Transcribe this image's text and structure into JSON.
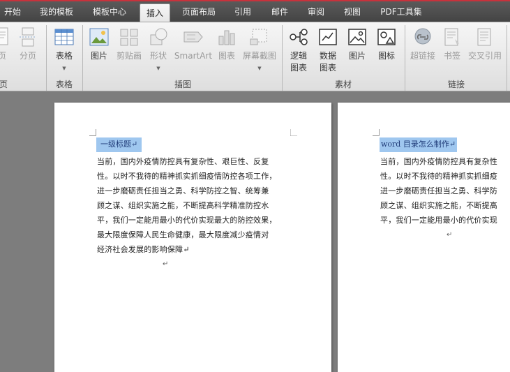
{
  "tabs": [
    {
      "label": "开始",
      "active": false
    },
    {
      "label": "我的模板",
      "active": false
    },
    {
      "label": "模板中心",
      "active": false
    },
    {
      "label": "插入",
      "active": true
    },
    {
      "label": "页面布局",
      "active": false
    },
    {
      "label": "引用",
      "active": false
    },
    {
      "label": "邮件",
      "active": false
    },
    {
      "label": "审阅",
      "active": false
    },
    {
      "label": "视图",
      "active": false
    },
    {
      "label": "PDF工具集",
      "active": false
    }
  ],
  "ribbon": {
    "buttons": {
      "page": "页",
      "page_break": "分页",
      "table": "表格",
      "picture": "图片",
      "clipart": "剪贴画",
      "shapes": "形状",
      "smartart": "SmartArt",
      "chart": "图表",
      "screenshot": "屏幕截图",
      "logic_chart_line1": "逻辑",
      "logic_chart_line2": "图表",
      "data_chart_line1": "数据",
      "data_chart_line2": "图表",
      "material_picture": "图片",
      "icon": "图标",
      "hyperlink": "超链接",
      "bookmark": "书签",
      "cross_ref": "交叉引用"
    },
    "groups": {
      "pages": "页",
      "tables": "表格",
      "illustrations": "插图",
      "material": "素材",
      "links": "链接"
    }
  },
  "document": {
    "page1": {
      "heading": "一级标题↵",
      "body": "当前，国内外疫情防控具有复杂性、艰巨性、反复\n性。以时不我待的精神抓实抓细疫情防控各项工作，\n进一步磨砺责任担当之勇、科学防控之智、统筹兼\n顾之谋、组织实施之能，不断提高科学精准防控水\n平，我们一定能用最小的代价实现最大的防控效果，\n最大限度保障人民生命健康，最大限度减少疫情对\n经济社会发展的影响保障↵",
      "empty_para": "↵"
    },
    "page2": {
      "heading": "word 目录怎么制作↵",
      "body": "当前，国内外疫情防控具有复杂性\n性。以时不我待的精神抓实抓细疫\n进一步磨砺责任担当之勇、科学防\n顾之谋、组织实施之能，不断提高\n平，我们一定能用最小的代价实现",
      "empty_para": "↵"
    }
  },
  "colors": {
    "tab_bar": "#4a4a4a",
    "accent_red": "#c8323c",
    "heading_highlight": "#9fc7ef",
    "doc_background": "#7d7d7d"
  }
}
